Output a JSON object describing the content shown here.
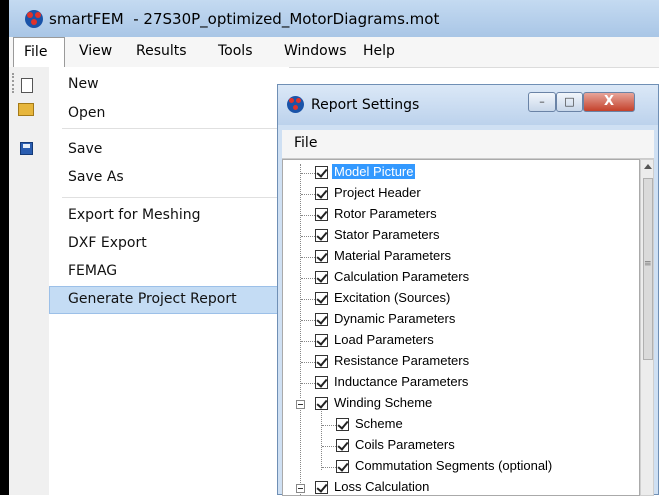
{
  "app": {
    "title": "smartFEM  - 27S30P_optimized_MotorDiagrams.mot"
  },
  "menubar": {
    "items": [
      "File",
      "View",
      "Results",
      "Tools",
      "Windows",
      "Help"
    ]
  },
  "file_menu": {
    "items": [
      {
        "label": "New",
        "icon": "new-file-icon"
      },
      {
        "label": "Open",
        "icon": "folder-open-icon"
      },
      {
        "label": "Save",
        "icon": "floppy-disk-icon"
      },
      {
        "label": "Save As"
      },
      {
        "label": "Export for Meshing"
      },
      {
        "label": "DXF Export"
      },
      {
        "label": "FEMAG"
      },
      {
        "label": "Generate  Project Report",
        "highlighted": true
      }
    ]
  },
  "dialog": {
    "title": "Report Settings",
    "menu": [
      "File"
    ],
    "window_buttons": {
      "minimize": "–",
      "maximize": "□",
      "close": "X"
    },
    "tree": [
      {
        "label": "Model Picture",
        "checked": true,
        "selected": true
      },
      {
        "label": "Project Header",
        "checked": true
      },
      {
        "label": "Rotor Parameters",
        "checked": true
      },
      {
        "label": "Stator Parameters",
        "checked": true
      },
      {
        "label": "Material Parameters",
        "checked": true
      },
      {
        "label": "Calculation Parameters",
        "checked": true
      },
      {
        "label": "Excitation (Sources)",
        "checked": true
      },
      {
        "label": "Dynamic Parameters",
        "checked": true
      },
      {
        "label": "Load Parameters",
        "checked": true
      },
      {
        "label": "Resistance Parameters",
        "checked": true
      },
      {
        "label": "Inductance Parameters",
        "checked": true
      },
      {
        "label": "Winding Scheme",
        "checked": true,
        "expanded": true
      },
      {
        "label": "Scheme",
        "checked": true,
        "child": true
      },
      {
        "label": "Coils Parameters",
        "checked": true,
        "child": true
      },
      {
        "label": "Commutation Segments (optional)",
        "checked": true,
        "child": true
      },
      {
        "label": "Loss Calculation",
        "checked": true,
        "expanded": true
      }
    ]
  },
  "colors": {
    "titlebar": "#b9d1ec",
    "highlight": "#c4dcf4",
    "selection": "#3399ff"
  }
}
